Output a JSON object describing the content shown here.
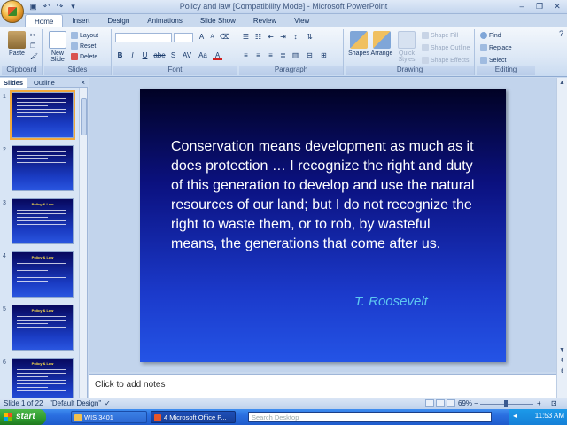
{
  "window": {
    "title": "Policy and law [Compatibility Mode] - Microsoft PowerPoint",
    "controls": [
      "–",
      "❐",
      "✕"
    ]
  },
  "tabs": [
    "Home",
    "Insert",
    "Design",
    "Animations",
    "Slide Show",
    "Review",
    "View"
  ],
  "ribbon": {
    "clipboard": {
      "paste": "Paste",
      "label": "Clipboard"
    },
    "slides": {
      "new_slide": "New Slide",
      "layout": "Layout",
      "reset": "Reset",
      "delete": "Delete",
      "label": "Slides"
    },
    "font": {
      "label": "Font",
      "bold": "B",
      "italic": "I",
      "underline": "U",
      "strike": "abe",
      "shadow": "S",
      "spacing": "AV",
      "case": "Aa",
      "color": "A",
      "grow": "A",
      "shrink": "A"
    },
    "paragraph": {
      "label": "Paragraph"
    },
    "drawing": {
      "shapes": "Shapes",
      "arrange": "Arrange",
      "quick_styles": "Quick Styles",
      "shape_fill": "Shape Fill",
      "shape_outline": "Shape Outline",
      "shape_effects": "Shape Effects",
      "label": "Drawing"
    },
    "editing": {
      "find": "Find",
      "replace": "Replace",
      "select": "Select",
      "label": "Editing"
    }
  },
  "panel": {
    "tabs": [
      "Slides",
      "Outline"
    ],
    "close": "×",
    "thumbnails": [
      {
        "num": "1",
        "title": "",
        "lines": 6,
        "selected": true
      },
      {
        "num": "2",
        "title": "",
        "lines": 5,
        "selected": false
      },
      {
        "num": "3",
        "title": "Policy & Law",
        "lines": 5,
        "selected": false
      },
      {
        "num": "4",
        "title": "Policy & Law",
        "lines": 6,
        "selected": false
      },
      {
        "num": "5",
        "title": "Policy & Law",
        "lines": 4,
        "selected": false
      },
      {
        "num": "6",
        "title": "Policy & Law",
        "lines": 7,
        "selected": false
      }
    ]
  },
  "slide": {
    "quote": "Conservation means development as much as it does protection … I recognize the right and duty of this generation to develop and use the natural resources of our land; but I do not recognize the right to waste them, or to rob, by wasteful means, the generations that come after us.",
    "author": "T. Roosevelt"
  },
  "notes": {
    "placeholder": "Click to add notes"
  },
  "status": {
    "slide_info": "Slide 1 of 22",
    "theme": "\"Default Design\"",
    "zoom": "69%"
  },
  "taskbar": {
    "start": "start",
    "tasks": [
      "WIS 3401",
      "4 Microsoft Office P..."
    ],
    "search_placeholder": "Search Desktop",
    "clock": "11:53 AM"
  }
}
